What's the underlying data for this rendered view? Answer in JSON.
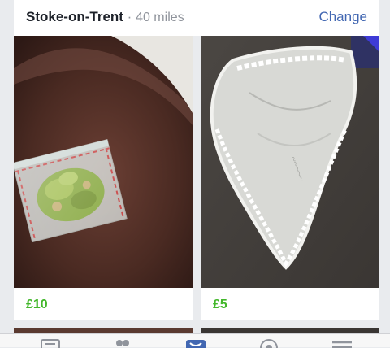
{
  "location": {
    "city": "Stoke-on-Trent",
    "separator": " · ",
    "radius": "40 miles",
    "change_label": "Change"
  },
  "listings": [
    {
      "price": "£10",
      "image": "bag-photo"
    },
    {
      "price": "£5",
      "image": "lingerie-photo"
    }
  ],
  "tabs": [
    {
      "icon": "news-feed-icon"
    },
    {
      "icon": "friends-icon"
    },
    {
      "icon": "marketplace-icon",
      "active": true
    },
    {
      "icon": "notifications-globe-icon"
    },
    {
      "icon": "menu-icon"
    }
  ],
  "colors": {
    "accent": "#4267b2",
    "price": "#42b72a",
    "background": "#e9ebee"
  }
}
